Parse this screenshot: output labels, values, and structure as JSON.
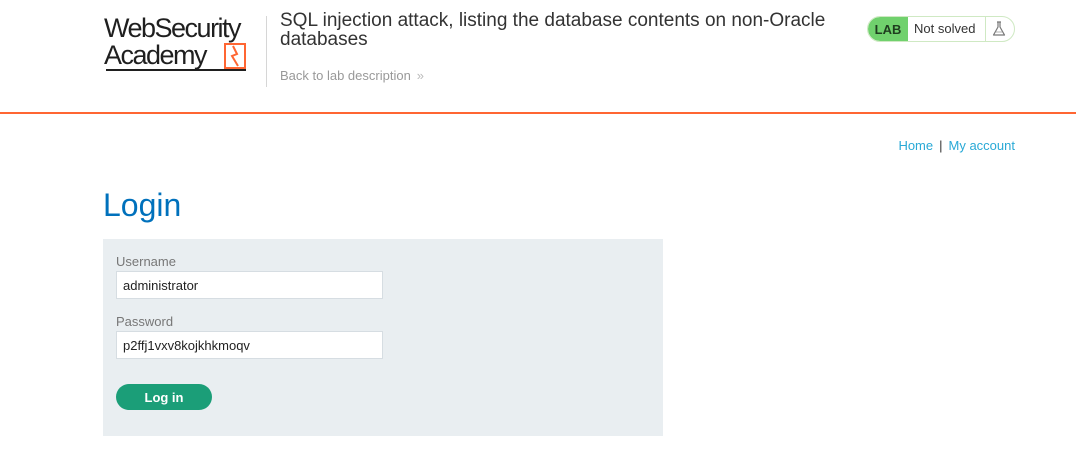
{
  "logo": {
    "line1": "WebSecurity",
    "line2": "Academy"
  },
  "lab": {
    "title": "SQL injection attack, listing the database contents on non-Oracle databases",
    "back_link": "Back to lab description",
    "back_chevron": "»",
    "badge": "LAB",
    "status": "Not solved"
  },
  "nav": {
    "home": "Home",
    "separator": "|",
    "account": "My account"
  },
  "page": {
    "heading": "Login"
  },
  "form": {
    "username_label": "Username",
    "username_value": "administrator",
    "password_label": "Password",
    "password_value": "p2ffj1vxv8kojkhkmoqv",
    "submit_label": "Log in"
  },
  "colors": {
    "accent_orange": "#ff6633",
    "heading_blue": "#0071bc",
    "link_blue": "#29a9d6",
    "lab_green": "#70d16d",
    "button_green": "#1b9e78",
    "panel_bg": "#e9eef1"
  },
  "icons": {
    "logo_bolt": "lightning-bolt-icon",
    "back_chevron": "double-chevron-right-icon",
    "lab_status": "flask-icon"
  }
}
